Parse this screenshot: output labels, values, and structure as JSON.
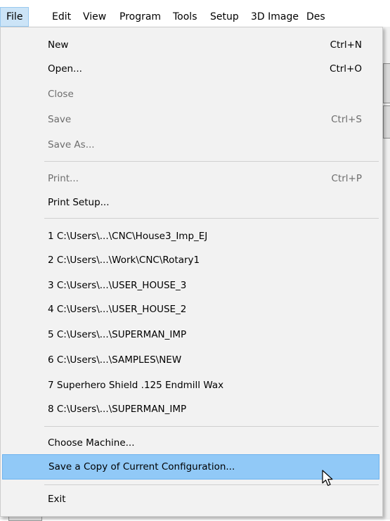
{
  "menubar": {
    "items": [
      "File",
      "Edit",
      "View",
      "Program",
      "Tools",
      "Setup",
      "3D Image",
      "Des"
    ],
    "active": "File"
  },
  "file_menu": {
    "group1": [
      {
        "label": "New",
        "shortcut": "Ctrl+N",
        "enabled": true
      },
      {
        "label": "Open...",
        "shortcut": "Ctrl+O",
        "enabled": true
      },
      {
        "label": "Close",
        "shortcut": "",
        "enabled": false
      },
      {
        "label": "Save",
        "shortcut": "Ctrl+S",
        "enabled": false
      },
      {
        "label": "Save As...",
        "shortcut": "",
        "enabled": false
      }
    ],
    "group2": [
      {
        "label": "Print...",
        "shortcut": "Ctrl+P",
        "enabled": false
      },
      {
        "label": "Print Setup...",
        "shortcut": "",
        "enabled": true
      }
    ],
    "recent_files": [
      "1 C:\\Users\\...\\CNC\\House3_Imp_EJ",
      "2 C:\\Users\\...\\Work\\CNC\\Rotary1",
      "3 C:\\Users\\...\\USER_HOUSE_3",
      "4 C:\\Users\\...\\USER_HOUSE_2",
      "5 C:\\Users\\...\\SUPERMAN_IMP",
      "6 C:\\Users\\...\\SAMPLES\\NEW",
      "7 Superhero Shield .125 Endmill Wax",
      "8 C:\\Users\\...\\SUPERMAN_IMP"
    ],
    "group4": [
      {
        "label": "Choose Machine...",
        "highlighted": false
      },
      {
        "label": "Save a Copy of Current Configuration...",
        "highlighted": true
      }
    ],
    "exit": {
      "label": "Exit"
    }
  },
  "colors": {
    "menu_bg": "#f2f2f2",
    "highlight": "#91c9f7",
    "disabled_text": "#6d6d6d",
    "active_menubar": "#cce4f7"
  }
}
